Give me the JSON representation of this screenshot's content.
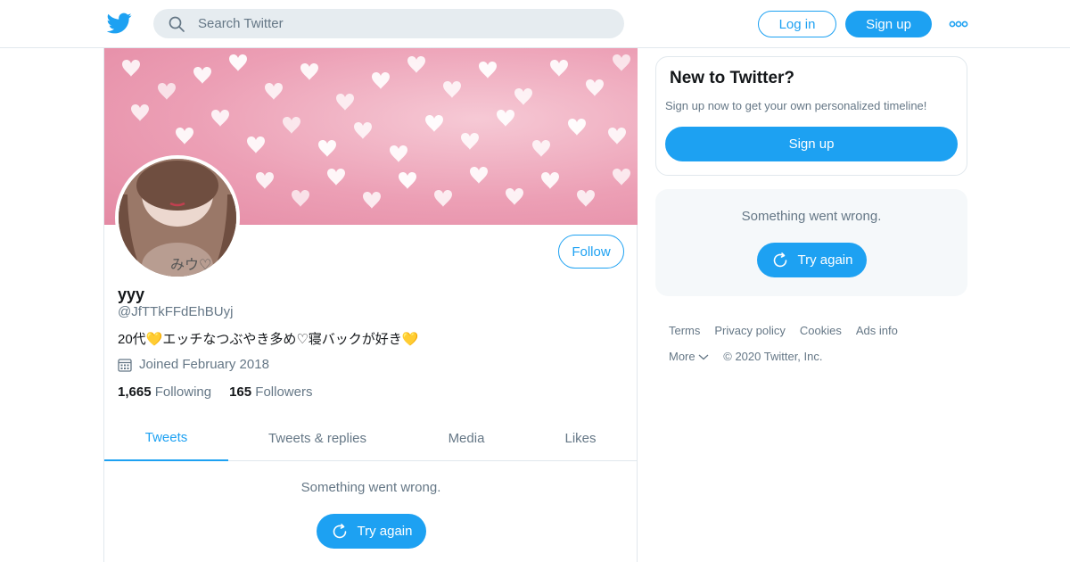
{
  "header": {
    "search_placeholder": "Search Twitter",
    "login_label": "Log in",
    "signup_label": "Sign up"
  },
  "profile": {
    "name": "yyy",
    "handle": "@JfTTkFFdEhBUyj",
    "bio": "20代💛エッチなつぶやき多め♡寝バックが好き💛",
    "joined": "Joined February 2018",
    "following_count": "1,665",
    "following_label": "Following",
    "followers_count": "165",
    "followers_label": "Followers",
    "follow_label": "Follow",
    "avatar_caption": "みウ♡"
  },
  "tabs": [
    {
      "label": "Tweets",
      "active": true
    },
    {
      "label": "Tweets & replies",
      "active": false
    },
    {
      "label": "Media",
      "active": false
    },
    {
      "label": "Likes",
      "active": false
    }
  ],
  "timeline": {
    "error_message": "Something went wrong.",
    "retry_label": "Try again"
  },
  "sidebar": {
    "title": "New to Twitter?",
    "subtitle": "Sign up now to get your own personalized timeline!",
    "signup_label": "Sign up",
    "error_message": "Something went wrong.",
    "retry_label": "Try again"
  },
  "footer": {
    "links": [
      "Terms",
      "Privacy policy",
      "Cookies",
      "Ads info"
    ],
    "more_label": "More",
    "copyright": "© 2020 Twitter, Inc."
  },
  "colors": {
    "accent": "#1da1f2",
    "muted_text": "#657786",
    "border": "#e1e8ed"
  }
}
